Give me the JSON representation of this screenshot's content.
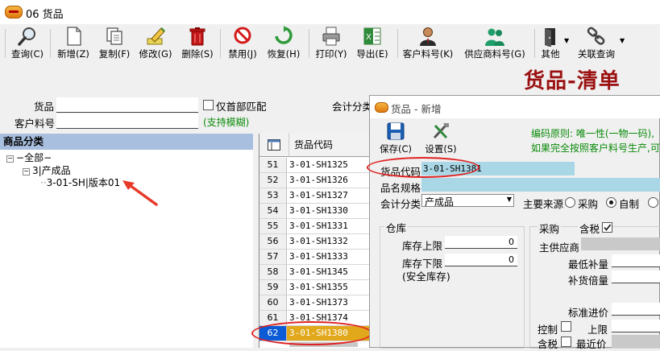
{
  "window": {
    "title": "06 货品"
  },
  "toolbar": {
    "buttons": [
      {
        "label": "查询(C)"
      },
      {
        "label": "新增(Z)"
      },
      {
        "label": "复制(F)"
      },
      {
        "label": "修改(G)"
      },
      {
        "label": "删除(S)"
      },
      {
        "label": "禁用(J)"
      },
      {
        "label": "恢复(H)"
      },
      {
        "label": "打印(Y)"
      },
      {
        "label": "导出(E)"
      },
      {
        "label": "客户料号(K)"
      },
      {
        "label": "供应商料号(G)"
      },
      {
        "label": "其他"
      },
      {
        "label": "关联查询"
      }
    ]
  },
  "brand_title": "货品-清单",
  "filter": {
    "goods_label": "货品",
    "first_match_label": "仅首部匹配",
    "customer_code_label": "客户料号",
    "fuzzy_hint": "(支持模糊)",
    "account_category_label": "会计分类"
  },
  "left_panel": {
    "header": "商品分类",
    "tree": [
      "全部",
      "3|产成品",
      "3-01-SH|版本01"
    ]
  },
  "grid": {
    "header": "货品代码",
    "rows": [
      {
        "num": "51",
        "code": "3-01-SH1325"
      },
      {
        "num": "52",
        "code": "3-01-SH1326"
      },
      {
        "num": "53",
        "code": "3-01-SH1327"
      },
      {
        "num": "54",
        "code": "3-01-SH1330"
      },
      {
        "num": "55",
        "code": "3-01-SH1331"
      },
      {
        "num": "56",
        "code": "3-01-SH1332"
      },
      {
        "num": "57",
        "code": "3-01-SH1333"
      },
      {
        "num": "58",
        "code": "3-01-SH1345"
      },
      {
        "num": "59",
        "code": "3-01-SH1355"
      },
      {
        "num": "60",
        "code": "3-01-SH1373"
      },
      {
        "num": "61",
        "code": "3-01-SH1374"
      },
      {
        "num": "62",
        "code": "3-01-SH1380"
      }
    ]
  },
  "dialog": {
    "title": "货品 - 新增",
    "save_label": "保存(C)",
    "settings_label": "设置(S)",
    "rule_line1": "编码原则: 唯一性(一物一码),",
    "rule_line2": "如果完全按照客户料号生产,可",
    "goods_code_label": "货品代码",
    "goods_code_value": "3-01-SH1381",
    "name_spec_label": "品名规格",
    "account_category_label": "会计分类",
    "account_category_value": "产成品",
    "main_source_label": "主要来源",
    "source_options": [
      "采购",
      "自制"
    ],
    "source_selected": "自制",
    "warehouse_group": "仓库",
    "stock_upper_label": "库存上限",
    "stock_upper_value": "0",
    "stock_lower_label": "库存下限",
    "stock_lower_sub": "(安全库存)",
    "stock_lower_value": "0",
    "purchase_label": "采购",
    "tax_label": "含税",
    "tax_checked": true,
    "main_supplier_label": "主供应商",
    "min_reorder_label": "最低补量",
    "reorder_multiple_label": "补货倍量",
    "std_price_label": "标准进价",
    "control_label": "控制",
    "upper_limit_label": "上限",
    "tax2_label": "含税",
    "recent_label": "最近价"
  }
}
